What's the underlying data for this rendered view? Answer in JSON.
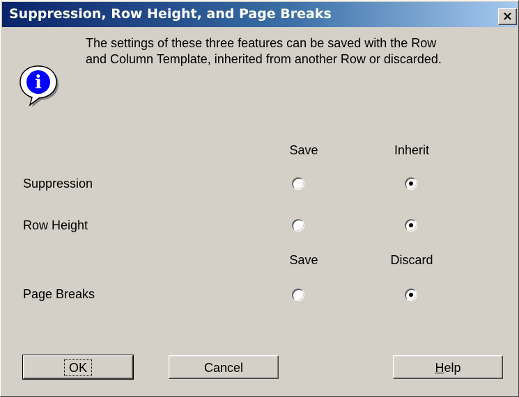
{
  "window": {
    "title": "Suppression, Row Height, and Page Breaks",
    "close_glyph": "×"
  },
  "message": {
    "line1": "The settings of these three features can be saved with the Row",
    "line2": "and Column Template, inherited from another Row or discarded."
  },
  "icon": {
    "name": "info-icon",
    "glyph": "i"
  },
  "group1": {
    "headers": {
      "save": "Save",
      "inherit": "Inherit"
    },
    "rows": [
      {
        "label": "Suppression",
        "selected": "inherit"
      },
      {
        "label": "Row Height",
        "selected": "inherit"
      }
    ]
  },
  "group2": {
    "headers": {
      "save": "Save",
      "discard": "Discard"
    },
    "rows": [
      {
        "label": "Page Breaks",
        "selected": "discard"
      }
    ]
  },
  "buttons": {
    "ok": "OK",
    "cancel": "Cancel",
    "help_first": "H",
    "help_rest": "elp"
  }
}
